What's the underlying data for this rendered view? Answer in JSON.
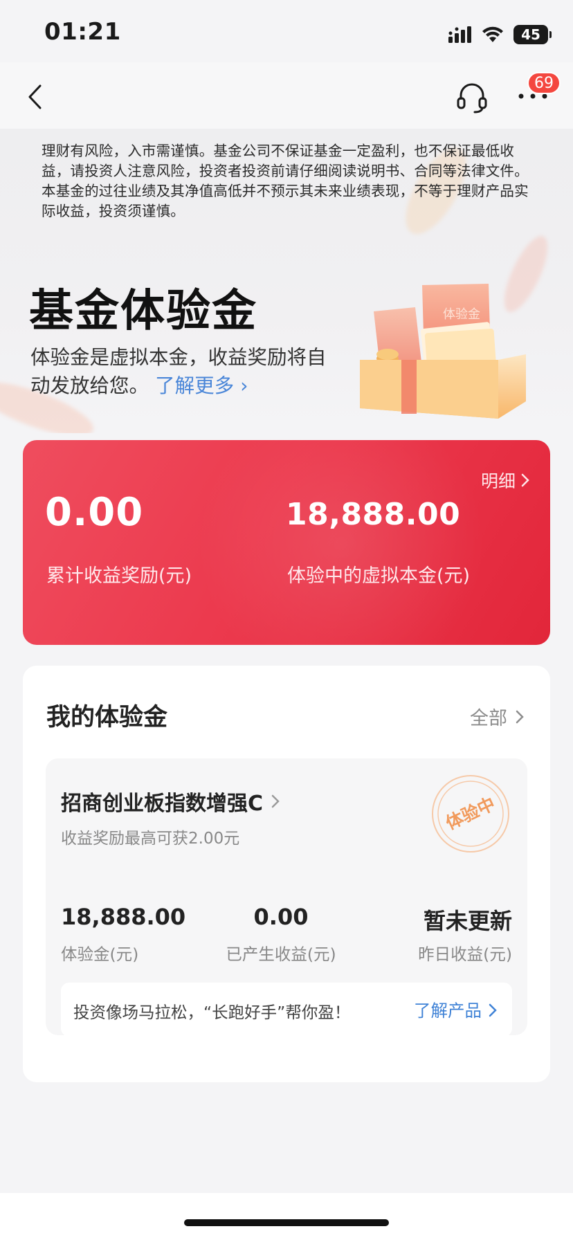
{
  "status_bar": {
    "time": "01:21",
    "battery": "45"
  },
  "nav": {
    "badge_count": "69",
    "icons": [
      "back-arrow-icon",
      "headset-icon",
      "more-dots-icon"
    ]
  },
  "disclaimer": "理财有风险，入市需谨慎。基金公司不保证基金一定盈利，也不保证最低收益，请投资人注意风险，投资者投资前请仔细阅读说明书、合同等法律文件。本基金的过往业绩及其净值高低并不预示其未来业绩表现，不等于理财产品实际收益，投资须谨慎。",
  "hero": {
    "title": "基金体验金",
    "desc": "体验金是虚拟本金，收益奖励将自动发放给您。",
    "link": "了解更多",
    "gift_label": "体验金"
  },
  "summary_card": {
    "detail_link": "明细",
    "reward_value": "0.00",
    "reward_label": "累计收益奖励(元)",
    "principal_value": "18,888.00",
    "principal_label": "体验中的虚拟本金(元)",
    "colors": {
      "start": "#ef4d5e",
      "end": "#e2263a"
    }
  },
  "my_section": {
    "title": "我的体验金",
    "all_link": "全部",
    "fund": {
      "name": "招商创业板指数增强C",
      "subtitle": "收益奖励最高可获2.00元",
      "stamp": "体验中",
      "stats": [
        {
          "value": "18,888.00",
          "label": "体验金(元)"
        },
        {
          "value": "0.00",
          "label": "已产生收益(元)"
        },
        {
          "value": "暂未更新",
          "label": "昨日收益(元)"
        }
      ],
      "promo_text": "投资像场马拉松，“长跑好手”帮你盈！",
      "promo_link": "了解产品"
    }
  }
}
